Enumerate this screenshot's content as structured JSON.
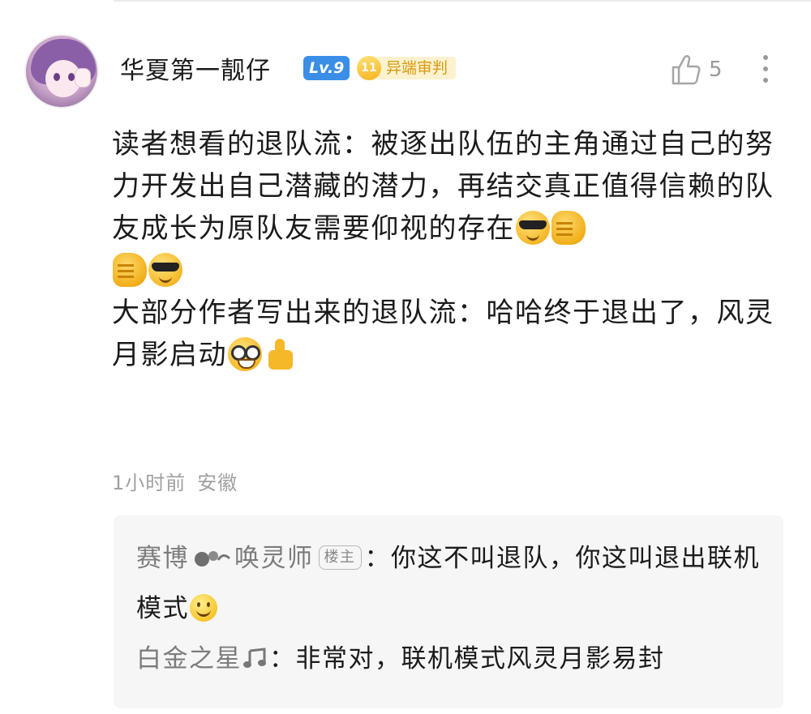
{
  "post": {
    "author": "华夏第一靓仔",
    "level_badge": "Lv.9",
    "medal_level": "11",
    "medal_label": "异端审判",
    "like_count": "5",
    "content_lines": [
      "读者想看的退队流：被逐出队伍的主角通过自己的努力开发出自己潜藏的潜力，再结交真正值得信赖的队友成长为原队友需要仰视的存在",
      "大部分作者写出来的退队流：哈哈终于退出了，风灵月影启动"
    ],
    "time": "1小时前",
    "location": "安徽"
  },
  "replies": [
    {
      "name_part1": "赛博",
      "name_part2": "唤灵师",
      "tag": "楼主",
      "separator": "：",
      "text": "你这不叫退队，你这叫退出联机模式"
    },
    {
      "name": "白金之星",
      "separator": "：",
      "text": "非常对，联机模式风灵月影易封"
    }
  ],
  "icons": {
    "like": "thumbs-up-outline-icon",
    "more": "vertical-dots-icon",
    "emojis": [
      "sunglasses-emoji",
      "fist-bump-emoji",
      "nerd-emoji",
      "thumbs-up-emoji",
      "smile-emoji"
    ]
  },
  "colors": {
    "level_badge": "#3a8ee6",
    "medal": "#f5b21d",
    "meta_text": "#a0a0a0",
    "reply_bg": "#f6f6f6"
  }
}
